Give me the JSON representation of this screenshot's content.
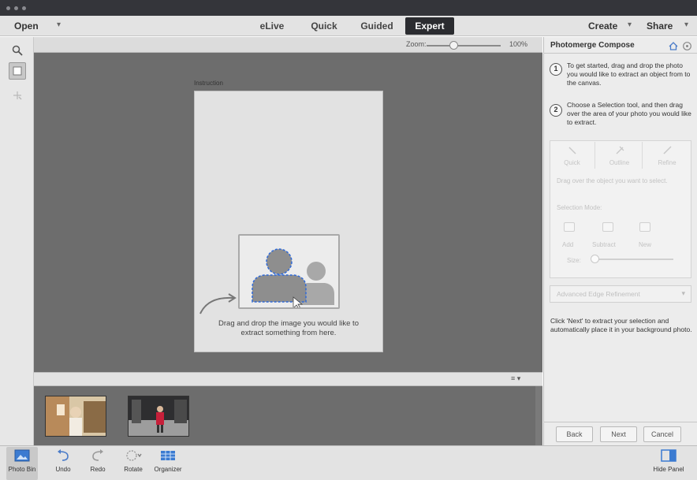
{
  "menu": {
    "open_label": "Open",
    "modes": [
      "eLive",
      "Quick",
      "Guided",
      "Expert"
    ],
    "active_mode": "Expert",
    "create_label": "Create",
    "share_label": "Share"
  },
  "tools": {
    "icons": [
      "zoom-icon",
      "move-icon",
      "selection-icon"
    ]
  },
  "options_bar": {
    "zoom_label": "Zoom:",
    "zoom_value": "100%",
    "zoom_level": 0.3
  },
  "canvas": {
    "title": "Instruction",
    "drop_text_line1": "Drag and drop the image you would like to",
    "drop_text_line2": "extract something from here."
  },
  "photo_bin": {
    "thumbnails": [
      "photo-thumbnail-1",
      "photo-thumbnail-2"
    ]
  },
  "panel": {
    "title": "Photomerge Compose",
    "step1_number": "1",
    "step1_text": "To get started, drag and drop the photo you would like to extract an object from to the canvas.",
    "step2_number": "2",
    "step2_text": "Choose a Selection tool, and then drag over the area of your photo you would like to extract.",
    "selection_tabs": [
      "Quick",
      "Outline",
      "Refine"
    ],
    "drag_hint": "Drag over the object you want to select.",
    "selection_mode_label": "Selection Mode:",
    "modes": [
      "Add",
      "Subtract",
      "New"
    ],
    "size_label": "Size:",
    "size_level": 0.05,
    "advanced_label": "Advanced Edge Refinement",
    "click_text": "Click 'Next' to extract your selection and automatically place it in your background photo.",
    "back_label": "Back",
    "next_label": "Next",
    "cancel_label": "Cancel"
  },
  "taskbar": {
    "photo_bin_label": "Photo Bin",
    "undo_label": "Undo",
    "redo_label": "Redo",
    "rotate_label": "Rotate",
    "organizer_label": "Organizer",
    "hide_panel_label": "Hide Panel"
  }
}
